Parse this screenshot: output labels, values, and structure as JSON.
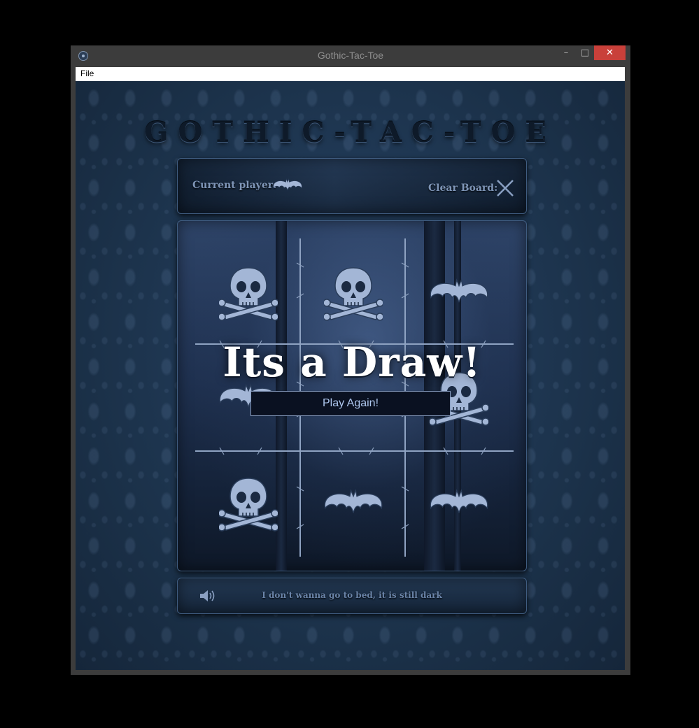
{
  "window": {
    "title": "Gothic-Tac-Toe",
    "controls": {
      "minimize": "–",
      "maximize": "□",
      "close": "✕"
    }
  },
  "menu": {
    "items": [
      {
        "label": "File"
      }
    ]
  },
  "game": {
    "title": "GOTHIC-TAC-TOE",
    "current_player_label": "Current player:",
    "current_player": "bat",
    "clear_board_label": "Clear Board:",
    "board": [
      [
        "skull",
        "skull",
        "bat"
      ],
      [
        "bat",
        "",
        "skull"
      ],
      [
        "skull",
        "bat",
        "bat"
      ]
    ],
    "result_text": "Its a Draw!",
    "play_again_label": "Play Again!",
    "now_playing": "I don't wanna go to bed, it is still dark"
  },
  "icons": {
    "app": "gear-icon",
    "current_player": "bat-icon",
    "clear_board": "cross-icon",
    "sound": "speaker-icon",
    "marks": {
      "skull": "skull-icon",
      "bat": "bat-icon"
    }
  },
  "colors": {
    "close_button": "#c9403a",
    "background": "#1b3149",
    "title": "#0e1a29",
    "label_text": "#7f96b8",
    "mark_fill": "#a3b6d6",
    "button_text": "#aec7ee"
  }
}
